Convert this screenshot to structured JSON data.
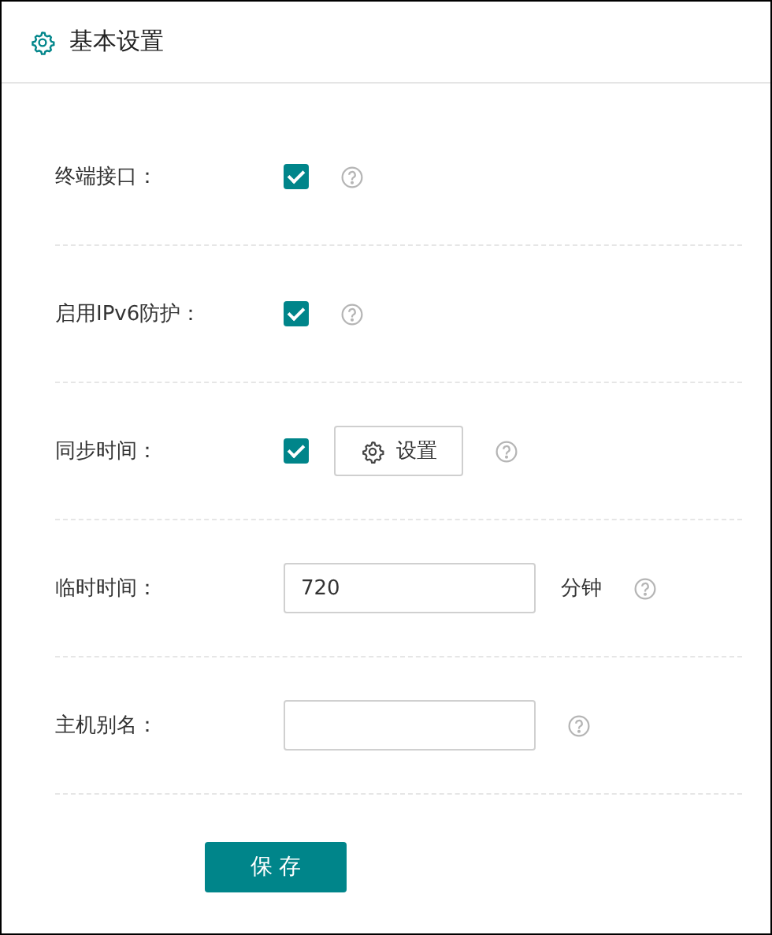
{
  "header": {
    "title": "基本设置"
  },
  "rows": [
    {
      "kind": "checkbox",
      "label": "终端接口：",
      "checked": true,
      "help": true
    },
    {
      "kind": "checkbox",
      "label": "启用IPv6防护：",
      "checked": true,
      "help": true
    },
    {
      "kind": "checkbox-button",
      "label": "同步时间：",
      "checked": true,
      "button": "设置",
      "help": true
    },
    {
      "kind": "input",
      "label": "临时时间：",
      "value": "720",
      "unit": "分钟",
      "help": true
    },
    {
      "kind": "input",
      "label": "主机别名：",
      "value": "",
      "help": true
    }
  ],
  "save_button": "保 存"
}
